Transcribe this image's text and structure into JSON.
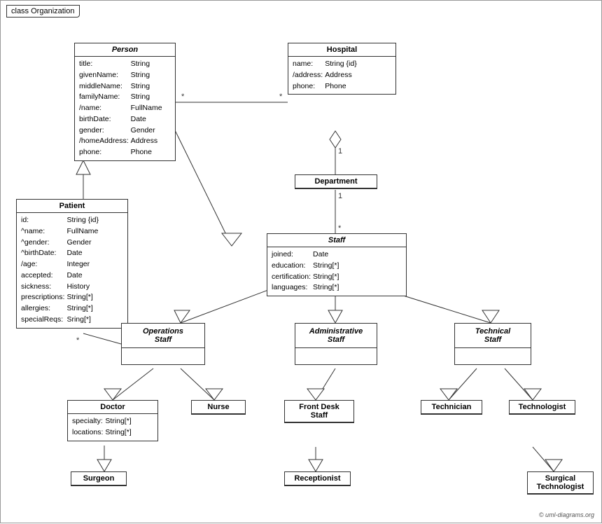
{
  "diagram": {
    "title": "class Organization",
    "copyright": "© uml-diagrams.org",
    "classes": {
      "person": {
        "name": "Person",
        "italic": true,
        "attributes": [
          [
            "title:",
            "String"
          ],
          [
            "givenName:",
            "String"
          ],
          [
            "middleName:",
            "String"
          ],
          [
            "familyName:",
            "String"
          ],
          [
            "/name:",
            "FullName"
          ],
          [
            "birthDate:",
            "Date"
          ],
          [
            "gender:",
            "Gender"
          ],
          [
            "/homeAddress:",
            "Address"
          ],
          [
            "phone:",
            "Phone"
          ]
        ]
      },
      "hospital": {
        "name": "Hospital",
        "italic": false,
        "attributes": [
          [
            "name:",
            "String {id}"
          ],
          [
            "/address:",
            "Address"
          ],
          [
            "phone:",
            "Phone"
          ]
        ]
      },
      "department": {
        "name": "Department",
        "italic": false,
        "attributes": []
      },
      "staff": {
        "name": "Staff",
        "italic": true,
        "attributes": [
          [
            "joined:",
            "Date"
          ],
          [
            "education:",
            "String[*]"
          ],
          [
            "certification:",
            "String[*]"
          ],
          [
            "languages:",
            "String[*]"
          ]
        ]
      },
      "patient": {
        "name": "Patient",
        "italic": false,
        "attributes": [
          [
            "id:",
            "String {id}"
          ],
          [
            "^name:",
            "FullName"
          ],
          [
            "^gender:",
            "Gender"
          ],
          [
            "^birthDate:",
            "Date"
          ],
          [
            "/age:",
            "Integer"
          ],
          [
            "accepted:",
            "Date"
          ],
          [
            "sickness:",
            "History"
          ],
          [
            "prescriptions:",
            "String[*]"
          ],
          [
            "allergies:",
            "String[*]"
          ],
          [
            "specialReqs:",
            "Sring[*]"
          ]
        ]
      },
      "operations_staff": {
        "name": "Operations\nStaff",
        "italic": true,
        "attributes": []
      },
      "administrative_staff": {
        "name": "Administrative\nStaff",
        "italic": true,
        "attributes": []
      },
      "technical_staff": {
        "name": "Technical\nStaff",
        "italic": true,
        "attributes": []
      },
      "doctor": {
        "name": "Doctor",
        "italic": false,
        "attributes": [
          [
            "specialty:",
            "String[*]"
          ],
          [
            "locations:",
            "String[*]"
          ]
        ]
      },
      "nurse": {
        "name": "Nurse",
        "italic": false,
        "attributes": []
      },
      "front_desk_staff": {
        "name": "Front Desk\nStaff",
        "italic": false,
        "attributes": []
      },
      "technician": {
        "name": "Technician",
        "italic": false,
        "attributes": []
      },
      "technologist": {
        "name": "Technologist",
        "italic": false,
        "attributes": []
      },
      "surgeon": {
        "name": "Surgeon",
        "italic": false,
        "attributes": []
      },
      "receptionist": {
        "name": "Receptionist",
        "italic": false,
        "attributes": []
      },
      "surgical_technologist": {
        "name": "Surgical\nTechnologist",
        "italic": false,
        "attributes": []
      }
    }
  }
}
